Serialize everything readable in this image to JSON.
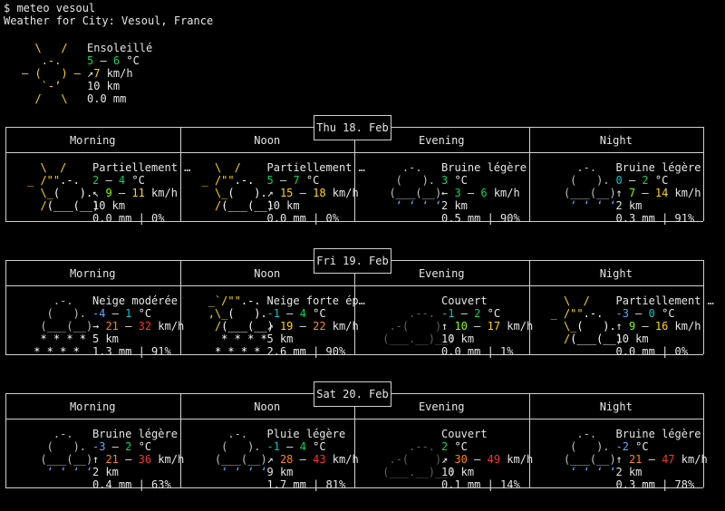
{
  "terminal": {
    "prompt": "$ meteo vesoul",
    "header": "Weather for City: Vesoul, France"
  },
  "current": {
    "desc": "Ensoleillé",
    "temp_lo": "5",
    "temp_hi": "6",
    "temp_unit": "°C",
    "wind_arrow": "↗",
    "wind": "7",
    "wind_unit": "km/h",
    "visibility": "10 km",
    "precip": "0.0 mm"
  },
  "periods": [
    "Morning",
    "Noon",
    "Evening",
    "Night"
  ],
  "days": [
    {
      "date": "Thu 18. Feb",
      "slots": [
        {
          "icon": "partly-cloudy",
          "desc": "Partiellement …",
          "t1": "2",
          "t2": "4",
          "t1c": "c2",
          "t2c": "c2",
          "arrow": "↖",
          "w1": "9",
          "w2": "11",
          "w1c": "c3",
          "w2c": "c4",
          "vis": "10 km",
          "precip": "0.0 mm | 0%"
        },
        {
          "icon": "partly-cloudy",
          "desc": "Partiellement …",
          "t1": "5",
          "t2": "7",
          "t1c": "c2",
          "t2c": "c2",
          "arrow": "↗",
          "w1": "15",
          "w2": "18",
          "w1c": "c4",
          "w2c": "c4",
          "vis": "10 km",
          "precip": "0.0 mm | 0%"
        },
        {
          "icon": "drizzle",
          "desc": "Bruine légère",
          "t1": "3",
          "t2": null,
          "t1c": "c2",
          "t2c": "",
          "arrow": "←",
          "w1": "3",
          "w2": "6",
          "w1c": "c2",
          "w2c": "c2",
          "vis": "2 km",
          "precip": "0.5 mm | 90%"
        },
        {
          "icon": "drizzle",
          "desc": "Bruine légère",
          "t1": "0",
          "t2": "2",
          "t1c": "c1",
          "t2c": "c2",
          "arrow": "↑",
          "w1": "7",
          "w2": "14",
          "w1c": "c3",
          "w2c": "c4",
          "vis": "2 km",
          "precip": "0.3 mm | 91%"
        }
      ]
    },
    {
      "date": "Fri 19. Feb",
      "slots": [
        {
          "icon": "snow",
          "desc": "Neige modérée",
          "t1": "-4",
          "t2": "1",
          "t1c": "b",
          "t2c": "c1",
          "arrow": "→",
          "w1": "21",
          "w2": "32",
          "w1c": "c5",
          "w2c": "c6",
          "vis": "5 km",
          "precip": "1.3 mm | 91%"
        },
        {
          "icon": "snow-sun",
          "desc": "Neige forte ép…",
          "t1": "-1",
          "t2": "4",
          "t1c": "c1",
          "t2c": "c2",
          "arrow": "↗",
          "w1": "19",
          "w2": "22",
          "w1c": "c4",
          "w2c": "c5",
          "vis": "5 km",
          "precip": "2.6 mm | 90%"
        },
        {
          "icon": "overcast",
          "desc": "Couvert",
          "t1": "-1",
          "t2": "2",
          "t1c": "c1",
          "t2c": "c2",
          "arrow": "↑",
          "w1": "10",
          "w2": "17",
          "w1c": "c3",
          "w2c": "c4",
          "vis": "10 km",
          "precip": "0.0 mm | 1%"
        },
        {
          "icon": "partly-cloudy",
          "desc": "Partiellement …",
          "t1": "-3",
          "t2": "0",
          "t1c": "b",
          "t2c": "c1",
          "arrow": "↑",
          "w1": "9",
          "w2": "16",
          "w1c": "c3",
          "w2c": "c4",
          "vis": "10 km",
          "precip": "0.0 mm | 0%"
        }
      ]
    },
    {
      "date": "Sat 20. Feb",
      "slots": [
        {
          "icon": "drizzle",
          "desc": "Bruine légère",
          "t1": "-3",
          "t2": "2",
          "t1c": "b",
          "t2c": "c2",
          "arrow": "↑",
          "w1": "21",
          "w2": "36",
          "w1c": "c5",
          "w2c": "c6",
          "vis": "2 km",
          "precip": "0.4 mm | 63%"
        },
        {
          "icon": "drizzle",
          "desc": "Pluie légère",
          "t1": "-1",
          "t2": "4",
          "t1c": "c1",
          "t2c": "c2",
          "arrow": "↗",
          "w1": "28",
          "w2": "43",
          "w1c": "c5",
          "w2c": "c6",
          "vis": "9 km",
          "precip": "1.7 mm | 81%"
        },
        {
          "icon": "overcast",
          "desc": "Couvert",
          "t1": "2",
          "t2": null,
          "t1c": "c2",
          "t2c": "",
          "arrow": "↗",
          "w1": "30",
          "w2": "49",
          "w1c": "c5",
          "w2c": "c6",
          "vis": "10 km",
          "precip": "0.1 mm | 14%"
        },
        {
          "icon": "drizzle",
          "desc": "Bruine légère",
          "t1": "-2",
          "t2": null,
          "t1c": "b",
          "t2c": "",
          "arrow": "↑",
          "w1": "21",
          "w2": "47",
          "w1c": "c5",
          "w2c": "c6",
          "vis": "2 km",
          "precip": "0.3 mm | 78%"
        }
      ]
    }
  ]
}
